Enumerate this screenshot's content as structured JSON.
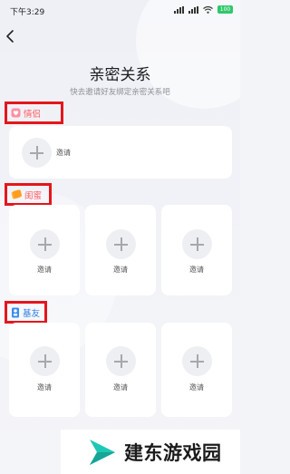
{
  "status_bar": {
    "time": "下午3:29",
    "battery": "100"
  },
  "header": {
    "title": "亲密关系",
    "subtitle": "快去邀请好友绑定亲密关系吧"
  },
  "sections": {
    "couple": {
      "label": "情侣",
      "icon": "heart-icon",
      "slots": [
        {
          "label": "邀请"
        }
      ]
    },
    "bestie": {
      "label": "闺蜜",
      "icon": "bestie-icon",
      "slots": [
        {
          "label": "邀请"
        },
        {
          "label": "邀请"
        },
        {
          "label": "邀请"
        }
      ]
    },
    "buddy": {
      "label": "基友",
      "icon": "buddy-icon",
      "slots": [
        {
          "label": "邀请"
        },
        {
          "label": "邀请"
        },
        {
          "label": "邀请"
        }
      ]
    }
  },
  "watermark": {
    "text": "建东游戏园"
  },
  "colors": {
    "highlight_border": "#e4161c",
    "label_text": "#ff5a5f",
    "background": "#f2f3f7",
    "card": "#ffffff",
    "watermark_logo": "#1fc7b5"
  }
}
